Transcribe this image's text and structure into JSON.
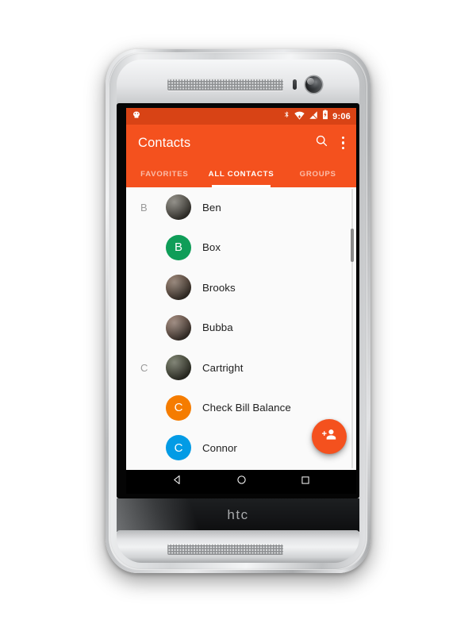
{
  "device": {
    "brand_logo": "htc",
    "speaker_top": "earpiece-speaker",
    "speaker_bottom": "bottom-speaker",
    "front_camera": "front-camera",
    "proximity_sensor": "proximity-sensor"
  },
  "status_bar": {
    "notification_icon": "cyanogenmod-icon",
    "icons": [
      "bluetooth-icon",
      "wifi-icon",
      "signal-off-icon",
      "battery-charging-icon"
    ],
    "time": "9:06",
    "background": "#d84315"
  },
  "app_bar": {
    "title": "Contacts",
    "search_icon": "search-icon",
    "overflow_icon": "overflow-menu-icon",
    "background": "#f4511e"
  },
  "tabs": {
    "items": [
      {
        "label": "FAVORITES",
        "active": false
      },
      {
        "label": "ALL CONTACTS",
        "active": true
      },
      {
        "label": "GROUPS",
        "active": false
      }
    ]
  },
  "contacts": {
    "rows": [
      {
        "section": "B",
        "name": "Ben",
        "avatar_type": "photo",
        "avatar_color": "#6e6a5e",
        "initial": ""
      },
      {
        "section": "",
        "name": "Box",
        "avatar_type": "initial",
        "avatar_color": "#0f9d58",
        "initial": "B"
      },
      {
        "section": "",
        "name": "Brooks",
        "avatar_type": "photo",
        "avatar_color": "#7b5a44",
        "initial": ""
      },
      {
        "section": "",
        "name": "Bubba",
        "avatar_type": "photo",
        "avatar_color": "#8a6552",
        "initial": ""
      },
      {
        "section": "C",
        "name": "Cartright",
        "avatar_type": "photo",
        "avatar_color": "#4a5236",
        "initial": ""
      },
      {
        "section": "",
        "name": "Check Bill Balance",
        "avatar_type": "initial",
        "avatar_color": "#f57c00",
        "initial": "C"
      },
      {
        "section": "",
        "name": "Connor",
        "avatar_type": "initial",
        "avatar_color": "#039be5",
        "initial": "C"
      }
    ]
  },
  "fab": {
    "icon": "add-person-icon",
    "color": "#f4511e"
  },
  "nav_bar": {
    "back": "back-icon",
    "home": "home-icon",
    "recents": "recents-icon"
  }
}
